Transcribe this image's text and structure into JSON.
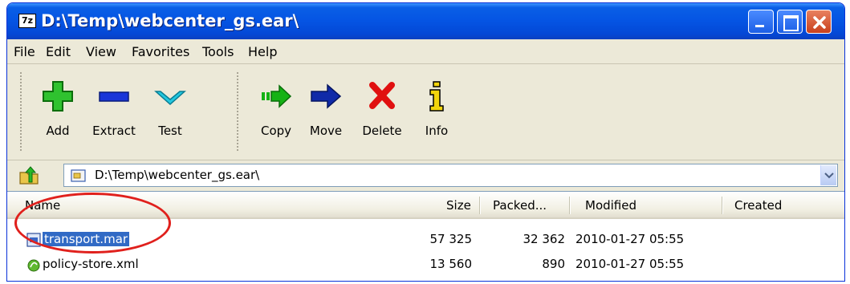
{
  "window": {
    "title": "D:\\Temp\\webcenter_gs.ear\\",
    "app_icon_text": "7z"
  },
  "menu": [
    "File",
    "Edit",
    "View",
    "Favorites",
    "Tools",
    "Help"
  ],
  "toolbar": {
    "add": "Add",
    "extract": "Extract",
    "test": "Test",
    "copy": "Copy",
    "move": "Move",
    "delete": "Delete",
    "info": "Info"
  },
  "address": {
    "path": "D:\\Temp\\webcenter_gs.ear\\"
  },
  "columns": [
    "Name",
    "Size",
    "Packed...",
    "Modified",
    "Created"
  ],
  "files": [
    {
      "name": "transport.mar",
      "size": "57 325",
      "packed": "32 362",
      "modified": "2010-01-27 05:55",
      "created": "",
      "icon": "archive-icon",
      "selected": true
    },
    {
      "name": "policy-store.xml",
      "size": "13 560",
      "packed": "890",
      "modified": "2010-01-27 05:55",
      "created": "",
      "icon": "xml-file-icon",
      "selected": false
    }
  ],
  "colors": {
    "titlebar": "#0554e3",
    "selection": "#316ac5",
    "annotation_circle": "#e0201c"
  }
}
